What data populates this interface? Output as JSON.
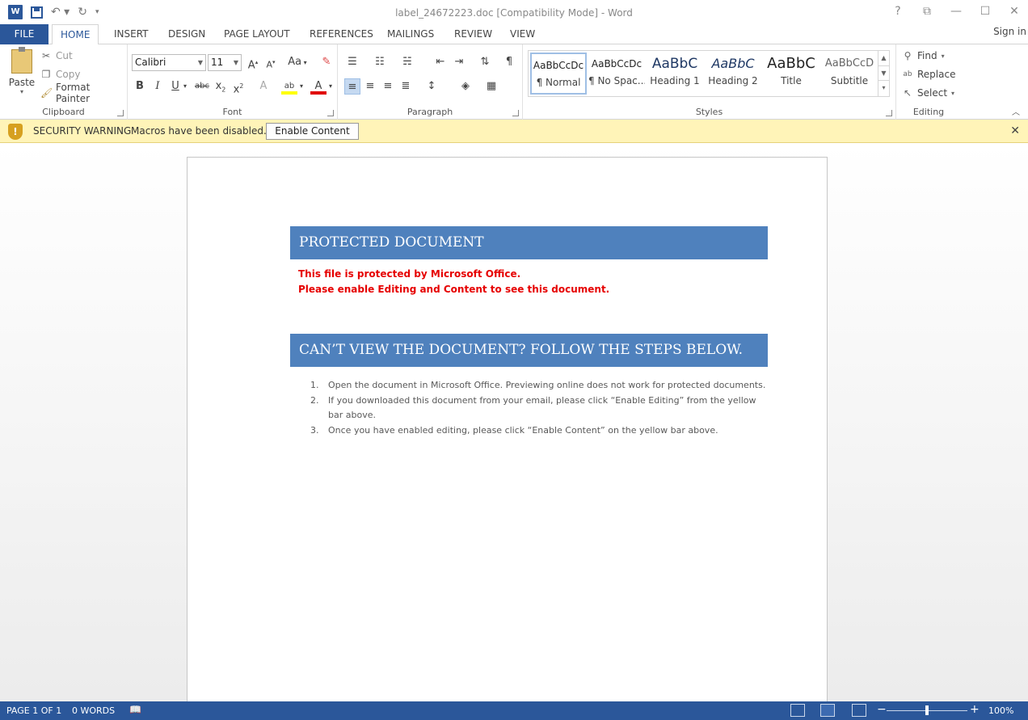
{
  "window": {
    "title": "label_24672223.doc [Compatibility Mode] - Word",
    "logo_letter": "W",
    "controls": [
      "?",
      "⧉",
      "—",
      "☐",
      "✕"
    ]
  },
  "tabs": {
    "file": "FILE",
    "items": [
      "HOME",
      "INSERT",
      "DESIGN",
      "PAGE LAYOUT",
      "REFERENCES",
      "MAILINGS",
      "REVIEW",
      "VIEW"
    ],
    "active": "HOME",
    "signin": "Sign in"
  },
  "ribbon": {
    "clipboard": {
      "label": "Clipboard",
      "paste": "Paste",
      "cut": "Cut",
      "copy": "Copy",
      "format_painter": "Format Painter"
    },
    "font": {
      "label": "Font",
      "family": "Calibri",
      "size": "11",
      "change_case": "Aa"
    },
    "paragraph": {
      "label": "Paragraph"
    },
    "styles": {
      "label": "Styles",
      "items": [
        {
          "sample": "AaBbCcDc",
          "name": "¶ Normal"
        },
        {
          "sample": "AaBbCcDc",
          "name": "¶ No Spac..."
        },
        {
          "sample": "AaBbC",
          "name": "Heading 1"
        },
        {
          "sample": "AaBbC",
          "name": "Heading 2"
        },
        {
          "sample": "AaBbC",
          "name": "Title"
        },
        {
          "sample": "AaBbCcD",
          "name": "Subtitle"
        }
      ]
    },
    "editing": {
      "label": "Editing",
      "find": "Find",
      "replace": "Replace",
      "select": "Select"
    }
  },
  "security_bar": {
    "title": "SECURITY WARNING",
    "message": "Macros have been disabled.",
    "button": "Enable Content"
  },
  "document": {
    "banner1": "PROTECTED DOCUMENT",
    "red_line1": "This file is protected by Microsoft Office.",
    "red_line2": "Please enable Editing and Content to  see this document.",
    "banner2": "CAN’T VIEW THE DOCUMENT? FOLLOW THE STEPS BELOW.",
    "steps": [
      {
        "num": "1.",
        "text": "Open the document in Microsoft Office. Previewing online does not work for protected documents."
      },
      {
        "num": "2.",
        "text": "If you downloaded this document from your email, please click “Enable  Editing”  from the yellow bar above."
      },
      {
        "num": "3.",
        "text": "Once you have enabled editing, please click “Enable  Content” on the yellow bar above."
      }
    ]
  },
  "status_bar": {
    "page": "PAGE 1 OF 1",
    "words": "0 WORDS",
    "zoom": "100%"
  }
}
